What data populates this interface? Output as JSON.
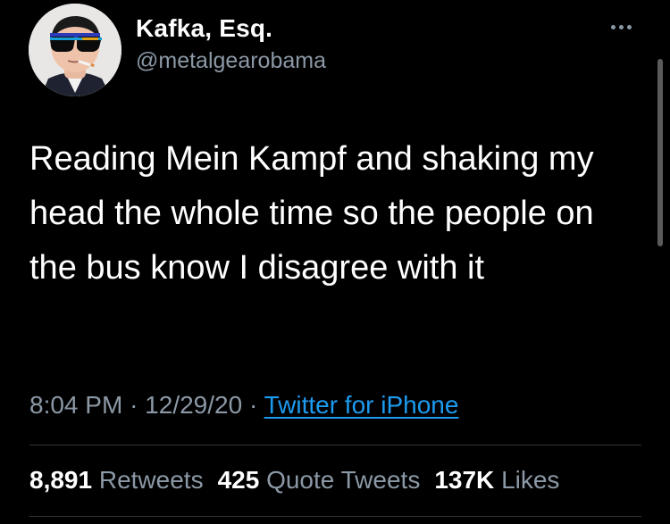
{
  "user": {
    "display_name": "Kafka, Esq.",
    "handle": "@metalgearobama"
  },
  "tweet": {
    "text": "Reading Mein Kampf and shaking my head the whole time so the people on the bus know I disagree with it",
    "time": "8:04 PM",
    "separator": "·",
    "date": "12/29/20",
    "source": "Twitter for iPhone"
  },
  "stats": {
    "retweets_count": "8,891",
    "retweets_label": "Retweets",
    "quotes_count": "425",
    "quotes_label": "Quote Tweets",
    "likes_count": "137K",
    "likes_label": "Likes"
  },
  "icons": {
    "more": "more-options-icon"
  },
  "colors": {
    "background": "#000000",
    "text": "#ffffff",
    "secondary": "#8b98a5",
    "link": "#1d9bf0",
    "divider": "#2f3336"
  }
}
